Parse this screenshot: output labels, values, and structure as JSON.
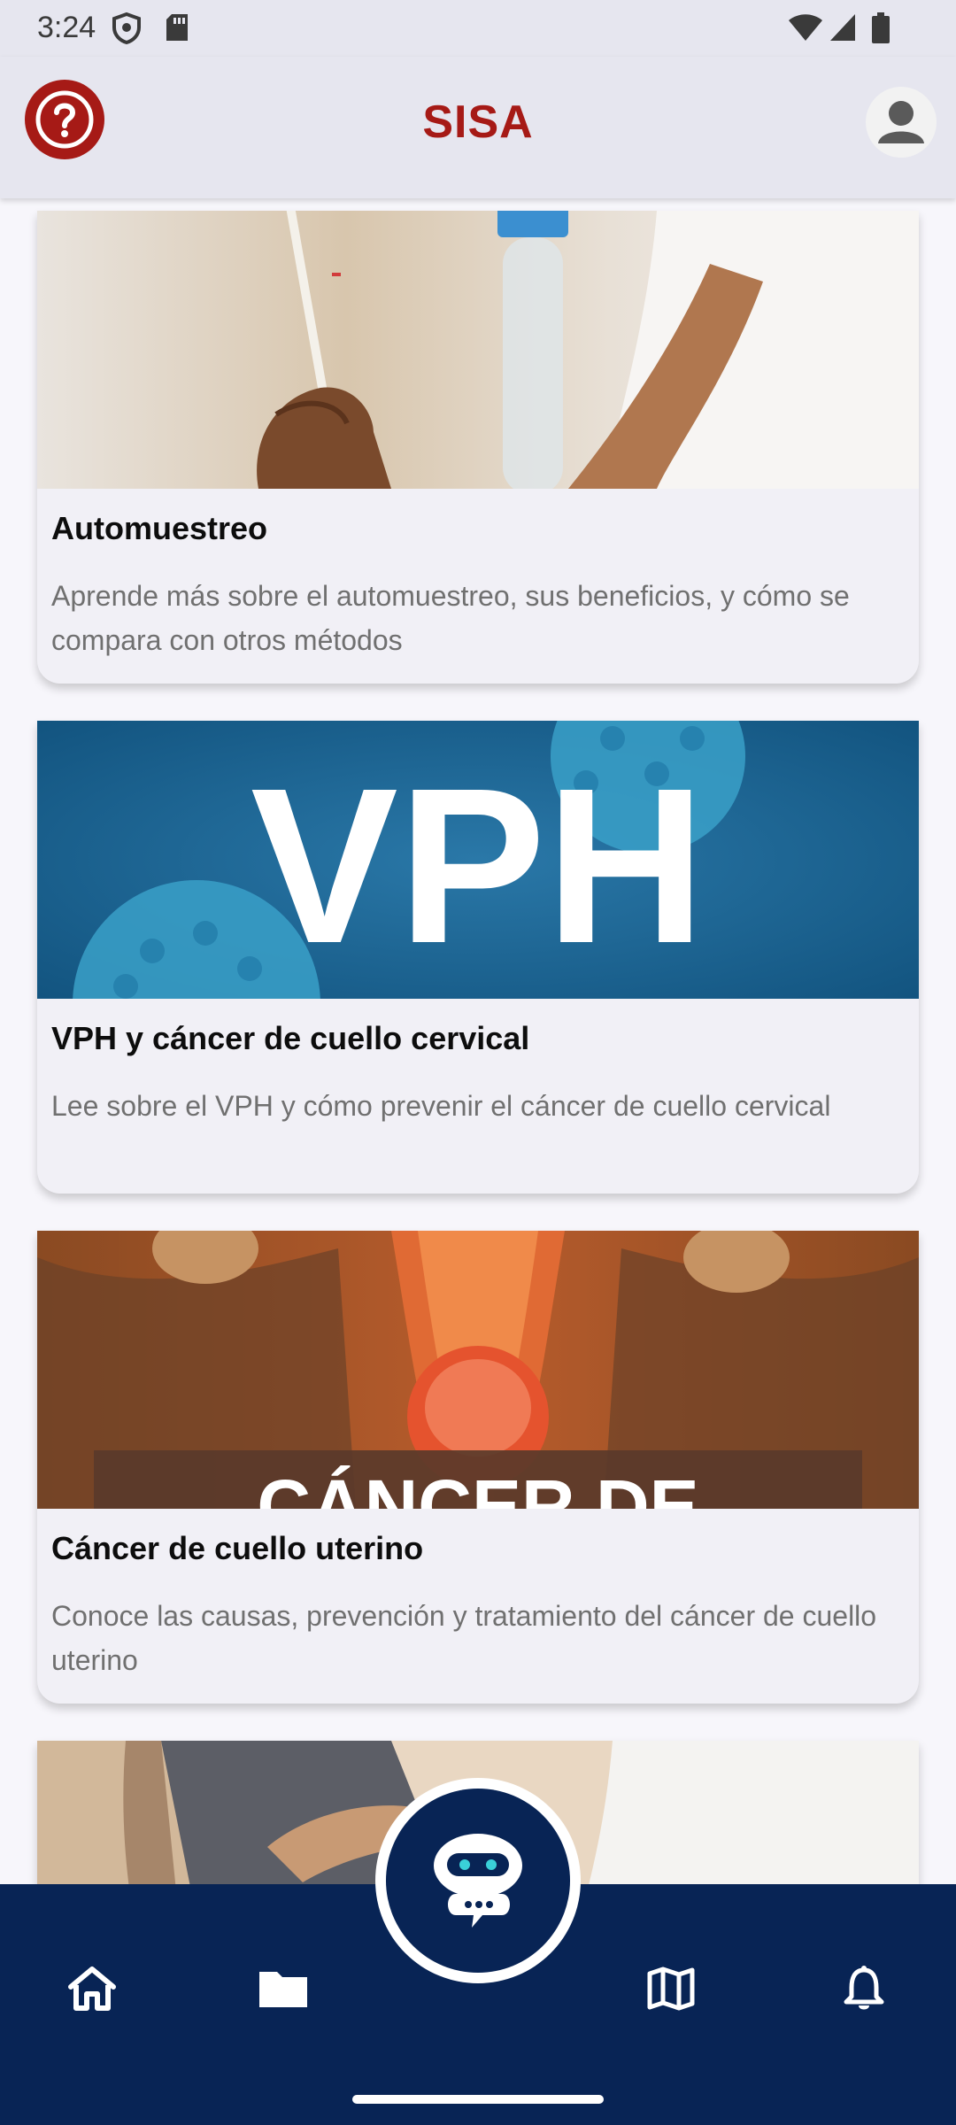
{
  "status_bar": {
    "time": "3:24"
  },
  "app_bar": {
    "title": "SISA"
  },
  "cards": [
    {
      "title": "Automuestreo",
      "description": "Aprende más sobre el automuestreo, sus beneficios, y cómo se compara con otros métodos"
    },
    {
      "title": "VPH y cáncer de cuello cervical",
      "description": "Lee sobre el VPH y cómo prevenir el cáncer de cuello cervical",
      "image_text": "VPH"
    },
    {
      "title": "Cáncer de cuello uterino",
      "description": "Conoce las causas, prevención y tratamiento del cáncer de cuello uterino",
      "image_text": "CÁNCER DE"
    }
  ],
  "nav": {
    "items": [
      "home-icon",
      "folder-icon",
      "chatbot-icon",
      "map-icon",
      "bell-icon"
    ],
    "accent": "#082455"
  },
  "colors": {
    "brand": "#a61a16",
    "nav_bg": "#082455"
  }
}
